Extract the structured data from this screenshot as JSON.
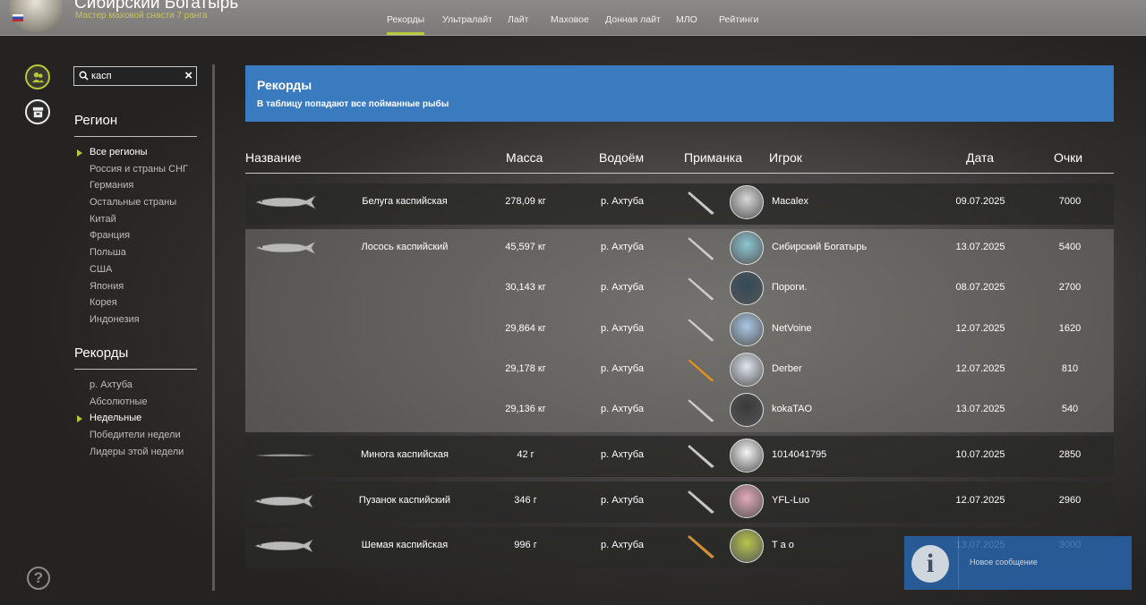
{
  "player": {
    "name": "Сибирский Богатырь",
    "rank": "Мастер маховой снасти 7 ранга"
  },
  "tabs": [
    {
      "label": "Рекорды",
      "active": true
    },
    {
      "label": "Ультралайт"
    },
    {
      "label": "Лайт"
    },
    {
      "label": "Маховое"
    },
    {
      "label": "Донная лайт"
    },
    {
      "label": "МЛО"
    },
    {
      "label": "Рейтинги"
    }
  ],
  "search": {
    "value": "касп"
  },
  "region": {
    "title": "Регион",
    "items": [
      "Все регионы",
      "Россия и страны СНГ",
      "Германия",
      "Остальные страны",
      "Китай",
      "Франция",
      "Польша",
      "США",
      "Япония",
      "Корея",
      "Индонезия"
    ],
    "selected": 0
  },
  "records_menu": {
    "title": "Рекорды",
    "items": [
      "р. Ахтуба",
      "Абсолютные",
      "Недельные",
      "Победители недели",
      "Лидеры этой недели"
    ],
    "selected": 2
  },
  "banner": {
    "title": "Рекорды",
    "subtitle": "В таблицу попадают все пойманные рыбы"
  },
  "columns": {
    "name": "Название",
    "mass": "Масса",
    "water": "Водоём",
    "bait": "Приманка",
    "player": "Игрок",
    "date": "Дата",
    "points": "Очки"
  },
  "records": [
    {
      "fish": "Белуга каспийская",
      "mass": "278,09 кг",
      "water": "р. Ахтуба",
      "player": "Macalex",
      "date": "09.07.2025",
      "points": "7000"
    },
    {
      "fish": "Лосось каспийский",
      "mass": "45,597 кг",
      "water": "р. Ахтуба",
      "player": "Сибирский Богатырь",
      "date": "13.07.2025",
      "points": "5400"
    },
    {
      "fish": "",
      "mass": "30,143 кг",
      "water": "р. Ахтуба",
      "player": "Пороги.",
      "date": "08.07.2025",
      "points": "2700"
    },
    {
      "fish": "",
      "mass": "29,864 кг",
      "water": "р. Ахтуба",
      "player": "NetVoine",
      "date": "12.07.2025",
      "points": "1620"
    },
    {
      "fish": "",
      "mass": "29,178 кг",
      "water": "р. Ахтуба",
      "player": "Derber",
      "date": "12.07.2025",
      "points": "810"
    },
    {
      "fish": "",
      "mass": "29,136 кг",
      "water": "р. Ахтуба",
      "player": "kokaTAO",
      "date": "13.07.2025",
      "points": "540"
    },
    {
      "fish": "Минога каспийская",
      "mass": "42 г",
      "water": "р. Ахтуба",
      "player": "1014041795",
      "date": "10.07.2025",
      "points": "2850"
    },
    {
      "fish": "Пузанок каспийский",
      "mass": "346 г",
      "water": "р. Ахтуба",
      "player": "YFL-Luo",
      "date": "12.07.2025",
      "points": "2960"
    },
    {
      "fish": "Шемая каспийская",
      "mass": "996 г",
      "water": "р. Ахтуба",
      "player": "T a o",
      "date": "13.07.2025",
      "points": "3000"
    }
  ],
  "toast": {
    "text": "Новое сообщение"
  },
  "colors": {
    "accent": "#b7cc3a",
    "banner": "#3a7bbf"
  }
}
